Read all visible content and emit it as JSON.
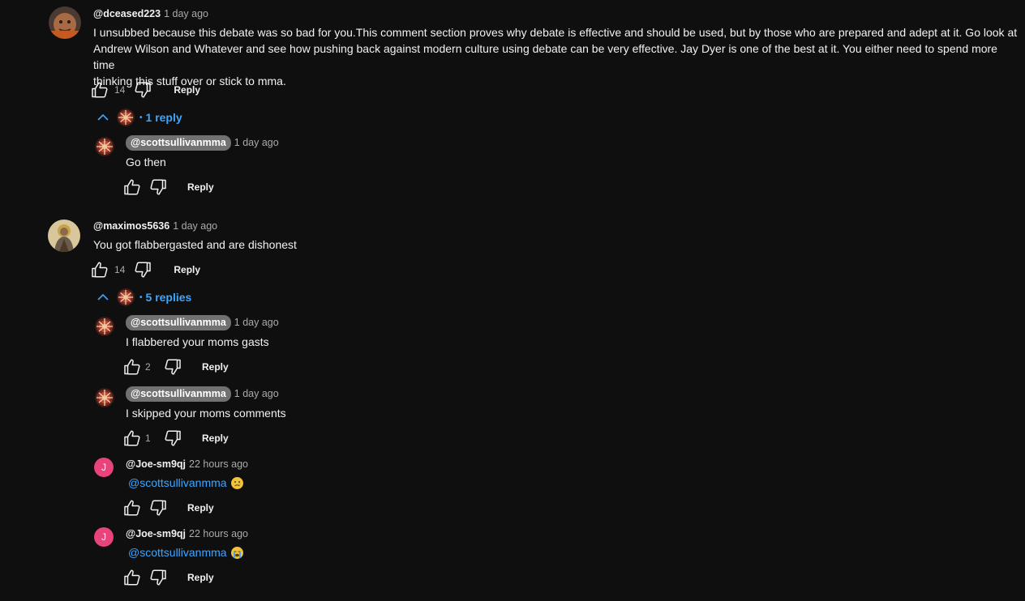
{
  "comments": [
    {
      "author": "@dceased223",
      "time": "1 day ago",
      "lines": [
        "I unsubbed because this debate was so bad for you.This comment section proves why debate is effective and should be used, but by those who are prepared and adept at it. Go look at",
        "Andrew Wilson and Whatever and see how pushing back against modern culture using debate can be very effective. Jay Dyer is one of the best at it. You either need to spend more time",
        "thinking this stuff over or stick to mma."
      ],
      "likes": "14",
      "reply_label": "Reply",
      "replies_toggle": "1 reply",
      "replies": [
        {
          "author": "@scottsullivanmma",
          "time": "1 day ago",
          "text": "Go then",
          "likes": "",
          "reply_label": "Reply"
        }
      ]
    },
    {
      "author": "@maximos5636",
      "time": "1 day ago",
      "text": "You got flabbergasted and are dishonest",
      "likes": "14",
      "reply_label": "Reply",
      "replies_toggle": "5 replies",
      "replies": [
        {
          "author": "@scottsullivanmma",
          "time": "1 day ago",
          "text": "I flabbered your moms gasts",
          "likes": "2",
          "reply_label": "Reply"
        },
        {
          "author": "@scottsullivanmma",
          "time": "1 day ago",
          "text": "I skipped your moms comments",
          "likes": "1",
          "reply_label": "Reply"
        },
        {
          "author": "@Joe-sm9qj",
          "time": "22 hours ago",
          "avatar_letter": "J",
          "mention": "@scottsullivanmma",
          "emoji": "sad-face-emoji",
          "likes": "",
          "reply_label": "Reply"
        },
        {
          "author": "@Joe-sm9qj",
          "time": "22 hours ago",
          "avatar_letter": "J",
          "mention": "@scottsullivanmma",
          "emoji": "crying-face-emoji",
          "likes": "",
          "reply_label": "Reply"
        }
      ]
    }
  ],
  "colors": {
    "background": "#0f0f0f",
    "link": "#3ea6ff",
    "chip": "#717171",
    "joe_avatar": "#e8437a"
  }
}
